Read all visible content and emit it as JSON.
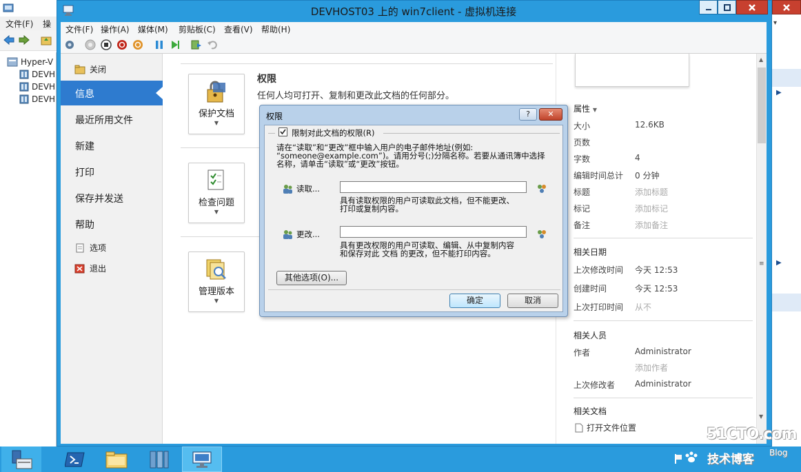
{
  "host_window": {
    "menu": [
      "文件(F)",
      "操作"
    ],
    "tree": {
      "root": "Hyper-V",
      "items": [
        "DEVH",
        "DEVH",
        "DEVH"
      ]
    }
  },
  "vm_window": {
    "title": "DEVHOST03 上的 win7client - 虚拟机连接",
    "menu": [
      "文件(F)",
      "操作(A)",
      "媒体(M)",
      "剪贴板(C)",
      "查看(V)",
      "帮助(H)"
    ]
  },
  "backstage": {
    "nav": {
      "close": "关闭",
      "info": "信息",
      "recent": "最近所用文件",
      "new": "新建",
      "print": "打印",
      "save_send": "保存并发送",
      "help": "帮助",
      "options": "选项",
      "exit": "退出"
    },
    "protect_btn": "保护文档",
    "inspect_btn": "检查问题",
    "versions_btn": "管理版本",
    "permissions_heading": "权限",
    "permissions_desc": "任何人均可打开、复制和更改此文档的任何部分。"
  },
  "properties": {
    "header": "属性",
    "rows": [
      {
        "label": "大小",
        "value": "12.6KB"
      },
      {
        "label": "页数",
        "value": ""
      },
      {
        "label": "字数",
        "value": "4"
      },
      {
        "label": "编辑时间总计",
        "value": "0 分钟"
      },
      {
        "label": "标题",
        "value": "添加标题"
      },
      {
        "label": "标记",
        "value": "添加标记"
      },
      {
        "label": "备注",
        "value": "添加备注"
      }
    ],
    "dates_header": "相关日期",
    "dates": [
      {
        "label": "上次修改时间",
        "value": "今天 12:53"
      },
      {
        "label": "创建时间",
        "value": "今天 12:53"
      },
      {
        "label": "上次打印时间",
        "value": "从不"
      }
    ],
    "people_header": "相关人员",
    "author_label": "作者",
    "author_value": "Administrator",
    "add_author": "添加作者",
    "modified_by_label": "上次修改者",
    "modified_by_value": "Administrator",
    "docs_header": "相关文档",
    "open_location": "打开文件位置"
  },
  "dialog": {
    "title": "权限",
    "restrict_checkbox": "限制对此文档的权限(R)",
    "restrict_checked": true,
    "instruction_line1": "请在“读取”和“更改”框中输入用户的电子邮件地址(例如:",
    "instruction_line2": "“someone@example.com”)。请用分号(;)分隔名称。若要从通讯簿中选择",
    "instruction_line3": "名称，请单击“读取”或“更改”按钮。",
    "read_label": "读取...",
    "read_value": "",
    "read_desc_1": "具有读取权限的用户可读取此文档，但不能更改、",
    "read_desc_2": "打印或复制内容。",
    "change_label": "更改...",
    "change_value": "",
    "change_desc_1": "具有更改权限的用户可读取、编辑、从中复制内容",
    "change_desc_2": "和保存对此 文档 的更改，但不能打印内容。",
    "more_options": "其他选项(O)...",
    "ok": "确定",
    "cancel": "取消",
    "help_glyph": "?",
    "close_glyph": "✕"
  },
  "watermark": {
    "line1": "51CTO.com",
    "line2": "技术博客",
    "line3": "Blog"
  },
  "colors": {
    "taskbar": "#2a9bdd",
    "nav_selected": "#2e7bcf",
    "dialog_frame": "#b9d1ea"
  }
}
